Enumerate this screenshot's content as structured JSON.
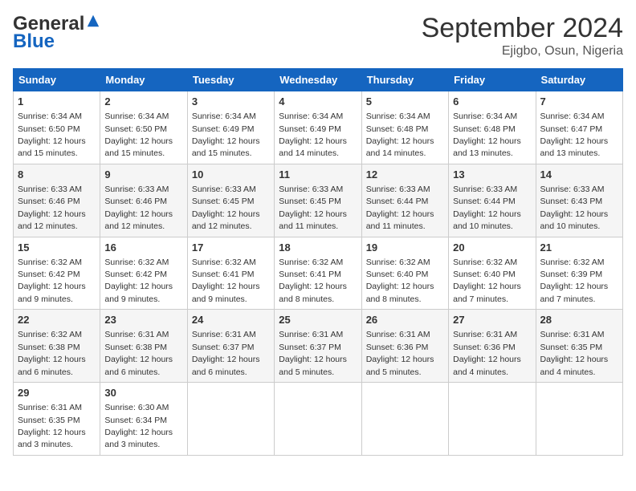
{
  "header": {
    "logo_line1": "General",
    "logo_line2": "Blue",
    "month": "September 2024",
    "location": "Ejigbo, Osun, Nigeria"
  },
  "weekdays": [
    "Sunday",
    "Monday",
    "Tuesday",
    "Wednesday",
    "Thursday",
    "Friday",
    "Saturday"
  ],
  "weeks": [
    [
      {
        "day": "1",
        "sunrise": "6:34 AM",
        "sunset": "6:50 PM",
        "daylight": "12 hours and 15 minutes."
      },
      {
        "day": "2",
        "sunrise": "6:34 AM",
        "sunset": "6:50 PM",
        "daylight": "12 hours and 15 minutes."
      },
      {
        "day": "3",
        "sunrise": "6:34 AM",
        "sunset": "6:49 PM",
        "daylight": "12 hours and 15 minutes."
      },
      {
        "day": "4",
        "sunrise": "6:34 AM",
        "sunset": "6:49 PM",
        "daylight": "12 hours and 14 minutes."
      },
      {
        "day": "5",
        "sunrise": "6:34 AM",
        "sunset": "6:48 PM",
        "daylight": "12 hours and 14 minutes."
      },
      {
        "day": "6",
        "sunrise": "6:34 AM",
        "sunset": "6:48 PM",
        "daylight": "12 hours and 13 minutes."
      },
      {
        "day": "7",
        "sunrise": "6:34 AM",
        "sunset": "6:47 PM",
        "daylight": "12 hours and 13 minutes."
      }
    ],
    [
      {
        "day": "8",
        "sunrise": "6:33 AM",
        "sunset": "6:46 PM",
        "daylight": "12 hours and 12 minutes."
      },
      {
        "day": "9",
        "sunrise": "6:33 AM",
        "sunset": "6:46 PM",
        "daylight": "12 hours and 12 minutes."
      },
      {
        "day": "10",
        "sunrise": "6:33 AM",
        "sunset": "6:45 PM",
        "daylight": "12 hours and 12 minutes."
      },
      {
        "day": "11",
        "sunrise": "6:33 AM",
        "sunset": "6:45 PM",
        "daylight": "12 hours and 11 minutes."
      },
      {
        "day": "12",
        "sunrise": "6:33 AM",
        "sunset": "6:44 PM",
        "daylight": "12 hours and 11 minutes."
      },
      {
        "day": "13",
        "sunrise": "6:33 AM",
        "sunset": "6:44 PM",
        "daylight": "12 hours and 10 minutes."
      },
      {
        "day": "14",
        "sunrise": "6:33 AM",
        "sunset": "6:43 PM",
        "daylight": "12 hours and 10 minutes."
      }
    ],
    [
      {
        "day": "15",
        "sunrise": "6:32 AM",
        "sunset": "6:42 PM",
        "daylight": "12 hours and 9 minutes."
      },
      {
        "day": "16",
        "sunrise": "6:32 AM",
        "sunset": "6:42 PM",
        "daylight": "12 hours and 9 minutes."
      },
      {
        "day": "17",
        "sunrise": "6:32 AM",
        "sunset": "6:41 PM",
        "daylight": "12 hours and 9 minutes."
      },
      {
        "day": "18",
        "sunrise": "6:32 AM",
        "sunset": "6:41 PM",
        "daylight": "12 hours and 8 minutes."
      },
      {
        "day": "19",
        "sunrise": "6:32 AM",
        "sunset": "6:40 PM",
        "daylight": "12 hours and 8 minutes."
      },
      {
        "day": "20",
        "sunrise": "6:32 AM",
        "sunset": "6:40 PM",
        "daylight": "12 hours and 7 minutes."
      },
      {
        "day": "21",
        "sunrise": "6:32 AM",
        "sunset": "6:39 PM",
        "daylight": "12 hours and 7 minutes."
      }
    ],
    [
      {
        "day": "22",
        "sunrise": "6:32 AM",
        "sunset": "6:38 PM",
        "daylight": "12 hours and 6 minutes."
      },
      {
        "day": "23",
        "sunrise": "6:31 AM",
        "sunset": "6:38 PM",
        "daylight": "12 hours and 6 minutes."
      },
      {
        "day": "24",
        "sunrise": "6:31 AM",
        "sunset": "6:37 PM",
        "daylight": "12 hours and 6 minutes."
      },
      {
        "day": "25",
        "sunrise": "6:31 AM",
        "sunset": "6:37 PM",
        "daylight": "12 hours and 5 minutes."
      },
      {
        "day": "26",
        "sunrise": "6:31 AM",
        "sunset": "6:36 PM",
        "daylight": "12 hours and 5 minutes."
      },
      {
        "day": "27",
        "sunrise": "6:31 AM",
        "sunset": "6:36 PM",
        "daylight": "12 hours and 4 minutes."
      },
      {
        "day": "28",
        "sunrise": "6:31 AM",
        "sunset": "6:35 PM",
        "daylight": "12 hours and 4 minutes."
      }
    ],
    [
      {
        "day": "29",
        "sunrise": "6:31 AM",
        "sunset": "6:35 PM",
        "daylight": "12 hours and 3 minutes."
      },
      {
        "day": "30",
        "sunrise": "6:30 AM",
        "sunset": "6:34 PM",
        "daylight": "12 hours and 3 minutes."
      },
      null,
      null,
      null,
      null,
      null
    ]
  ]
}
